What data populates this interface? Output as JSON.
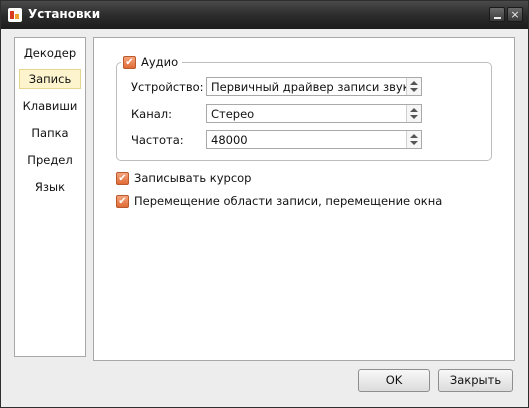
{
  "window": {
    "title": "Установки",
    "app_icon": "app-icon",
    "minimize_icon": "minimize-icon",
    "close_icon": "close-icon",
    "close_glyph": "×"
  },
  "sidebar": {
    "items": [
      {
        "label": "Декодер",
        "selected": false
      },
      {
        "label": "Запись",
        "selected": true
      },
      {
        "label": "Клавиши",
        "selected": false
      },
      {
        "label": "Папка",
        "selected": false
      },
      {
        "label": "Предел",
        "selected": false
      },
      {
        "label": "Язык",
        "selected": false
      }
    ]
  },
  "audio": {
    "label": "Аудио",
    "checked": true,
    "fields": {
      "device": {
        "label": "Устройство:",
        "value": "Первичный драйвер записи звука"
      },
      "channel": {
        "label": "Канал:",
        "value": "Стерео"
      },
      "rate": {
        "label": "Частота:",
        "value": "48000"
      }
    }
  },
  "options": {
    "record_cursor": {
      "label": "Записывать курсор",
      "checked": true
    },
    "move_area": {
      "label": "Перемещение области записи, перемещение окна",
      "checked": true
    }
  },
  "buttons": {
    "ok": "OK",
    "close": "Закрыть"
  },
  "glyphs": {
    "check": "✔"
  },
  "colors": {
    "titlebar": "#2a2a2a",
    "checkbox": "#e06b35",
    "selected_item": "#fdf4ce"
  }
}
